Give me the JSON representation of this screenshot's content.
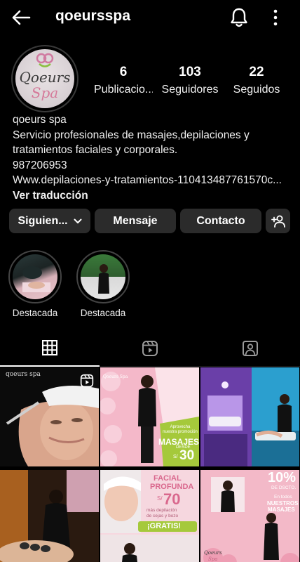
{
  "header": {
    "username": "qoeursspa",
    "back_icon": "arrow-left-icon",
    "bell_icon": "bell-icon",
    "more_icon": "vertical-dots-icon"
  },
  "avatar": {
    "logo_line1": "Qoeurs",
    "logo_line2": "Spa"
  },
  "stats": {
    "posts_count": "6",
    "posts_label": "Publicacio...",
    "followers_count": "103",
    "followers_label": "Seguidores",
    "following_count": "22",
    "following_label": "Seguidos"
  },
  "bio": {
    "name": "qoeurs spa",
    "line1": "Servicio profesionales de masajes,depilaciones y",
    "line2": "tratamientos faciales y corporales.",
    "phone": "987206953",
    "link": "Www.depilaciones-y-tratamientos-110413487761570c...",
    "translate": "Ver traducción"
  },
  "actions": {
    "following": "Siguien...",
    "message": "Mensaje",
    "contact": "Contacto",
    "add_user_icon": "add-person-icon"
  },
  "highlights": [
    {
      "label": "Destacada"
    },
    {
      "label": "Destacada"
    }
  ],
  "tabs": [
    "grid-icon",
    "reels-icon",
    "tagged-icon"
  ],
  "posts": {
    "p1": {
      "caption": "qoeurs spa"
    },
    "p2": {
      "badge": "Qoeurs Spa",
      "promo_small": "Aprovecha nuestra promoción",
      "promo_big": "MASAJES",
      "promo_sub": "DESDE",
      "price_prefix": "S/",
      "price": "30"
    },
    "p5": {
      "line1": "FACIAL",
      "line2": "PROFUNDA",
      "price_prefix": "S/",
      "price": "70",
      "desc1": "más depilación",
      "desc2": "de cejas y bozo",
      "free": "¡GRATIS!"
    },
    "p6": {
      "pct": "10%",
      "dsct": "DE DSCTO.",
      "line1": "En todos",
      "line2": "NUESTROS",
      "line3": "MASAJES",
      "logo1": "Qoeurs",
      "logo2": "Spa"
    }
  },
  "colors": {
    "background": "#000000",
    "button": "#2b2b2b",
    "accent_pink": "#e7829f"
  }
}
